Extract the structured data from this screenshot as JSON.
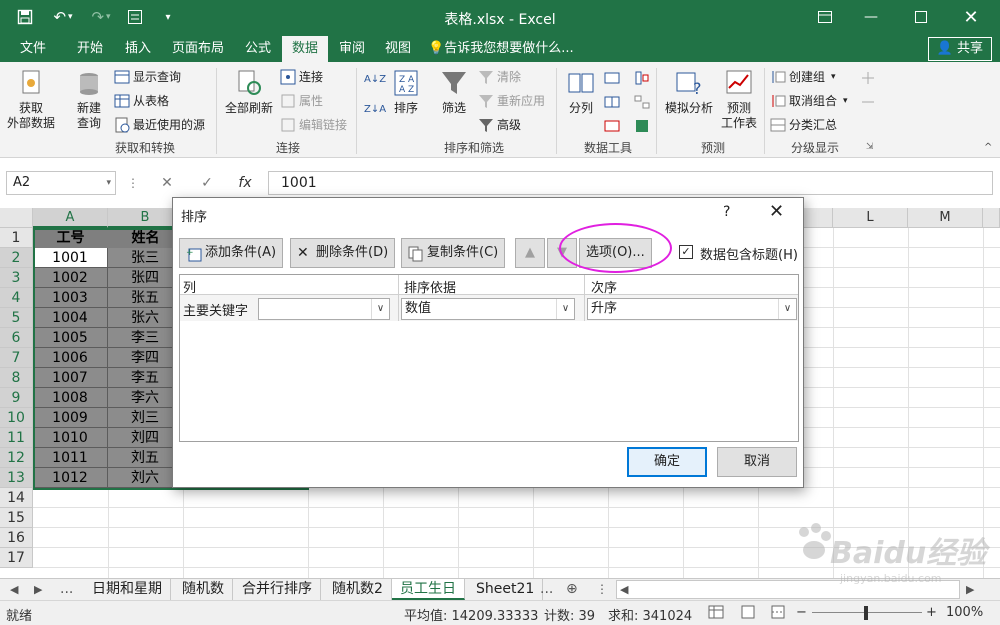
{
  "window": {
    "title": "表格.xlsx - Excel"
  },
  "ribbon_tabs": [
    "文件",
    "开始",
    "插入",
    "页面布局",
    "公式",
    "数据",
    "审阅",
    "视图"
  ],
  "tell_me": "告诉我您想要做什么...",
  "share_label": "共享",
  "ribbon": {
    "get_external": "获取\n外部数据",
    "new_query": "新建\n查询",
    "show_queries": "显示查询",
    "from_table": "从表格",
    "recent_sources": "最近使用的源",
    "group_get_transform": "获取和转换",
    "refresh_all": "全部刷新",
    "connections": "连接",
    "properties": "属性",
    "edit_links": "编辑链接",
    "group_connections": "连接",
    "sort_az": "A↓Z",
    "sort_za": "Z↓A",
    "sort": "排序",
    "filter": "筛选",
    "clear": "清除",
    "reapply": "重新应用",
    "advanced": "高级",
    "group_sort_filter": "排序和筛选",
    "text_to_columns": "分列",
    "group_data_tools": "数据工具",
    "what_if": "模拟分析",
    "forecast_sheet": "预测\n工作表",
    "group_forecast": "预测",
    "group_create": "创建组",
    "ungroup": "取消组合",
    "subtotal": "分类汇总",
    "group_outline": "分级显示"
  },
  "formula_bar": {
    "name_box": "A2",
    "fx": "fx",
    "value": "1001"
  },
  "grid": {
    "columns": [
      "A",
      "B",
      "L",
      "M"
    ],
    "rows": [
      "1",
      "2",
      "3",
      "4",
      "5",
      "6",
      "7",
      "8",
      "9",
      "10",
      "11",
      "12",
      "13",
      "14",
      "15",
      "16",
      "17"
    ],
    "header_row": [
      "工号",
      "姓名"
    ],
    "data": [
      [
        "1001",
        "张三"
      ],
      [
        "1002",
        "张四"
      ],
      [
        "1003",
        "张五"
      ],
      [
        "1004",
        "张六"
      ],
      [
        "1005",
        "李三"
      ],
      [
        "1006",
        "李四"
      ],
      [
        "1007",
        "李五"
      ],
      [
        "1008",
        "李六"
      ],
      [
        "1009",
        "刘三"
      ],
      [
        "1010",
        "刘四"
      ],
      [
        "1011",
        "刘五"
      ],
      [
        "1012",
        "刘六"
      ]
    ]
  },
  "sheet_tabs": [
    "日期和星期",
    "随机数",
    "合并行排序",
    "随机数2",
    "员工生日",
    "Sheet21"
  ],
  "active_sheet": "员工生日",
  "sheet_nav_ellipsis": "...",
  "status": {
    "ready": "就绪",
    "average": "平均值: 14209.33333",
    "count": "计数: 39",
    "sum": "求和: 341024",
    "zoom": "100%"
  },
  "dialog": {
    "title": "排序",
    "help": "?",
    "close": "✕",
    "add_level": "添加条件(A)",
    "delete_level": "删除条件(D)",
    "copy_level": "复制条件(C)",
    "options": "选项(O)...",
    "has_headers": "数据包含标题(H)",
    "col_header": "列",
    "sort_on_header": "排序依据",
    "order_header": "次序",
    "primary_key": "主要关键字",
    "column_value": "",
    "sort_on_value": "数值",
    "order_value": "升序",
    "ok": "确定",
    "cancel": "取消"
  },
  "colors": {
    "excel_green": "#217346",
    "highlight": "#e020e0",
    "accent_blue": "#0078d7"
  },
  "watermark": {
    "main": "Baidu经验",
    "sub": "jingyan.baidu.com"
  }
}
